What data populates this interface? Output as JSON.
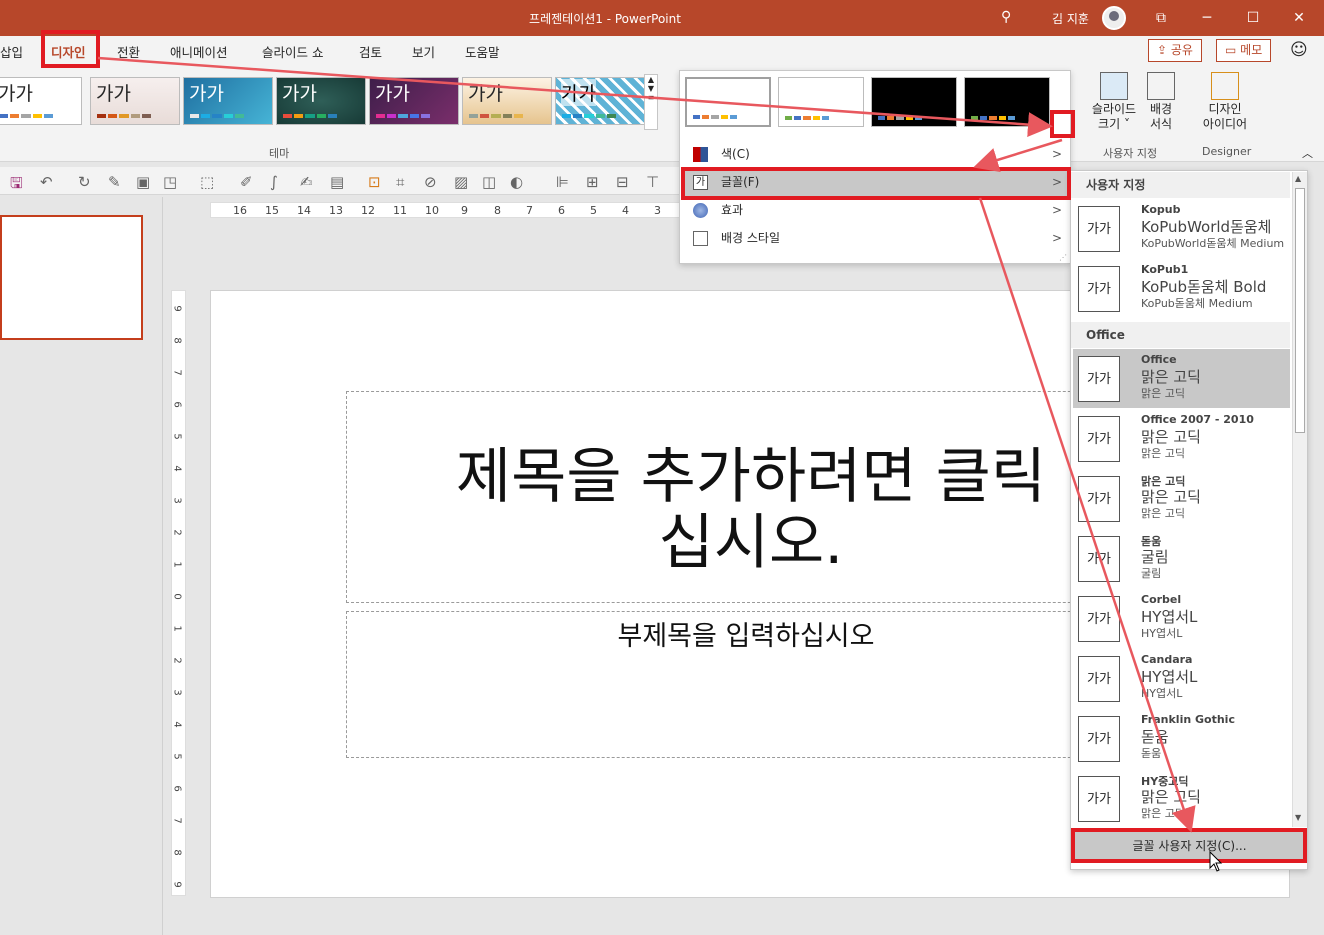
{
  "window": {
    "title": "프레젠테이션1  -  PowerPoint",
    "user": "김 지훈",
    "controls": [
      "⧉",
      "─",
      "☐",
      "✕"
    ]
  },
  "tabs": [
    "삽입",
    "디자인",
    "전환",
    "애니메이션",
    "슬라이드 쇼",
    "검토",
    "보기",
    "도움말"
  ],
  "share": {
    "share_label": "공유",
    "comment_label": "메모"
  },
  "ribbon": {
    "theme_group_label": "테마",
    "customize_group_label": "사용자 지정",
    "designer_group_label": "Designer",
    "slide_size_label1": "슬라이드",
    "slide_size_label2": "크기",
    "format_bg_label1": "배경",
    "format_bg_label2": "서식",
    "design_ideas_label1": "디자인",
    "design_ideas_label2": "아이디어",
    "theme_sample": "가가"
  },
  "ruler": {
    "h_ticks": [
      "16",
      "15",
      "14",
      "13",
      "12",
      "11",
      "10",
      "9",
      "8",
      "7",
      "6",
      "5",
      "4",
      "3"
    ],
    "v_ticks": [
      "9",
      "8",
      "7",
      "6",
      "5",
      "4",
      "3",
      "2",
      "1",
      "0",
      "1",
      "2",
      "3",
      "4",
      "5",
      "6",
      "7",
      "8",
      "9"
    ]
  },
  "slide": {
    "title_line1": "제목을 추가하려면 클릭",
    "title_line2": "십시오.",
    "subtitle": "부제목을 입력하십시오"
  },
  "menu": {
    "items": [
      {
        "label": "색(C)",
        "icon": "color-icon"
      },
      {
        "label": "글꼴(F)",
        "icon": "font-icon"
      },
      {
        "label": "효과",
        "icon": "effects-icon"
      },
      {
        "label": "배경 스타일",
        "icon": "background-style-icon"
      }
    ]
  },
  "font_panel": {
    "custom_header": "사용자 지정",
    "office_header": "Office",
    "icon_text": "가가",
    "custom_fonts": [
      {
        "name": "Kopub",
        "heading": "KoPubWorld돋움체",
        "body": "KoPubWorld돋움체 Medium"
      },
      {
        "name": "KoPub1",
        "heading": "KoPub돋움체 Bold",
        "body": "KoPub돋움체 Medium"
      }
    ],
    "office_fonts": [
      {
        "name": "Office",
        "heading": "맑은 고딕",
        "body": "맑은 고딕"
      },
      {
        "name": "Office 2007 - 2010",
        "heading": "맑은 고딕",
        "body": "맑은 고딕"
      },
      {
        "name": "맑은 고딕",
        "heading": "맑은 고딕",
        "body": "맑은 고딕"
      },
      {
        "name": "돋움",
        "heading": "굴림",
        "body": "굴림"
      },
      {
        "name": "Corbel",
        "heading": "HY엽서L",
        "body": "HY엽서L"
      },
      {
        "name": "Candara",
        "heading": "HY엽서L",
        "body": "HY엽서L"
      },
      {
        "name": "Franklin Gothic",
        "heading": "돋움",
        "body": "돋움"
      },
      {
        "name": "HY중고딕",
        "heading": "맑은 고딕",
        "body": "맑은 고딕"
      }
    ],
    "customize_label": "글꼴 사용자 지정(C)..."
  },
  "colors": {
    "brand": "#b7472a",
    "annotation": "#e11b22"
  }
}
